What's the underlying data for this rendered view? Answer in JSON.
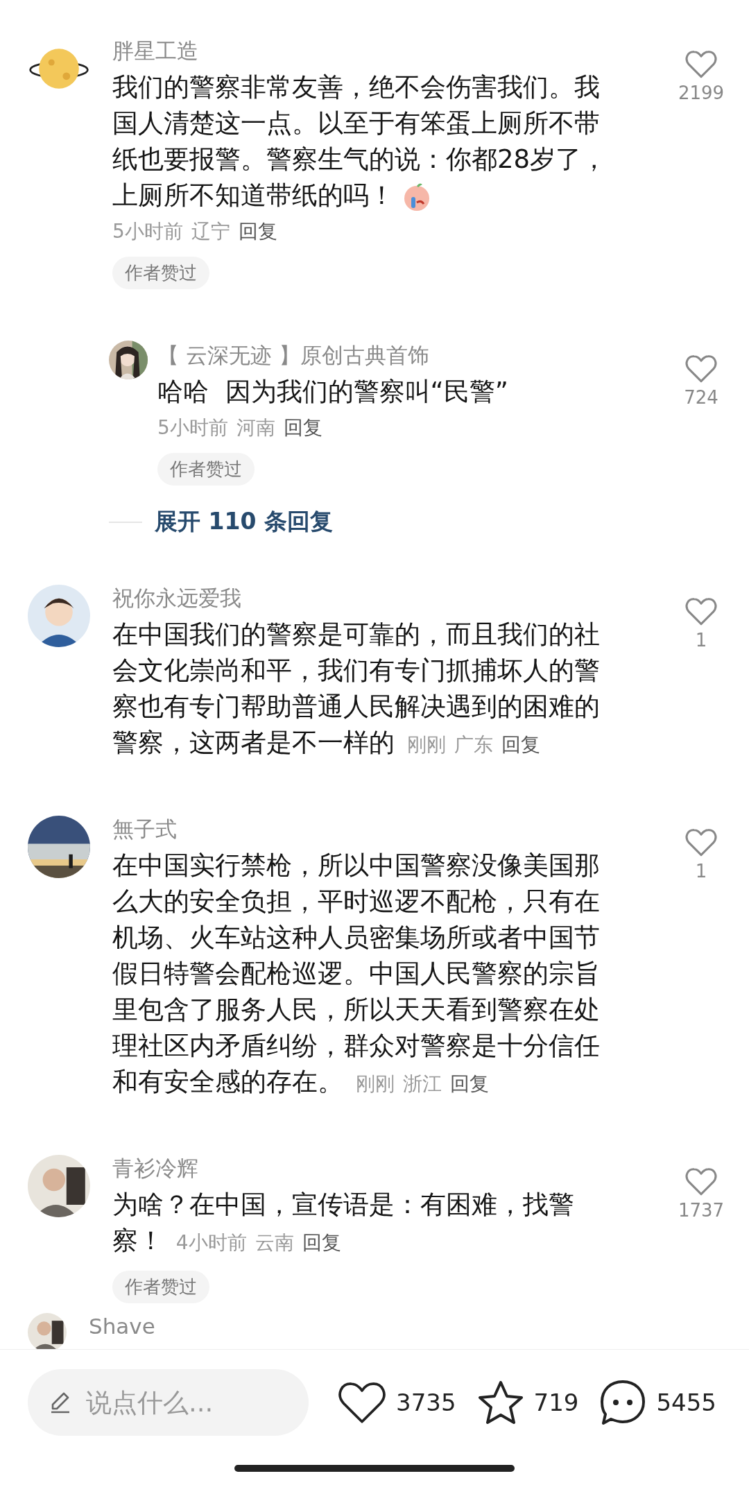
{
  "comments": [
    {
      "name": "胖星工造",
      "text": "我们的警察非常友善，绝不会伤害我们。我国人清楚这一点。以至于有笨蛋上厕所不带纸也要报警。警察生气的说：你都28岁了，上厕所不知道带纸的吗！",
      "sticker": true,
      "time": "5小时前",
      "location": "辽宁",
      "reply_label": "回复",
      "kind": "meta_below",
      "badge": "作者赞过",
      "likes": "2199",
      "replies": [
        {
          "name": "【 云深无迹 】原创古典首饰",
          "text": "哈哈  因为我们的警察叫“民警”",
          "time": "5小时前",
          "location": "河南",
          "reply_label": "回复",
          "kind": "meta_below",
          "badge": "作者赞过",
          "likes": "724"
        }
      ],
      "expand_label": "展开 110 条回复"
    },
    {
      "name": "祝你永远爱我",
      "text": "在中国我们的警察是可靠的，而且我们的社会文化崇尚和平，我们有专门抓捕坏人的警察也有专门帮助普通人民解决遇到的困难的警察，这两者是不一样的",
      "time": "刚刚",
      "location": "广东",
      "reply_label": "回复",
      "kind": "meta_inline",
      "likes": "1"
    },
    {
      "name": "無子式",
      "text": "在中国实行禁枪，所以中国警察没像美国那么大的安全负担，平时巡逻不配枪，只有在机场、火车站这种人员密集场所或者中国节假日特警会配枪巡逻。中国人民警察的宗旨里包含了服务人民，所以天天看到警察在处理社区内矛盾纠纷，群众对警察是十分信任和有安全感的存在。",
      "time": "刚刚",
      "location": "浙江",
      "reply_label": "回复",
      "kind": "meta_inline",
      "likes": "1"
    },
    {
      "name": "青衫冷辉",
      "text": "为啥？在中国，宣传语是：有困难，找警察！",
      "time": "4小时前",
      "location": "云南",
      "reply_label": "回复",
      "kind": "meta_inline",
      "badge": "作者赞过",
      "likes": "1737"
    }
  ],
  "partial_comment": {
    "name": "Shave"
  },
  "bottom_bar": {
    "input": {
      "placeholder": "说点什么..."
    },
    "likes": "3735",
    "favorites": "719",
    "comments": "5455"
  }
}
